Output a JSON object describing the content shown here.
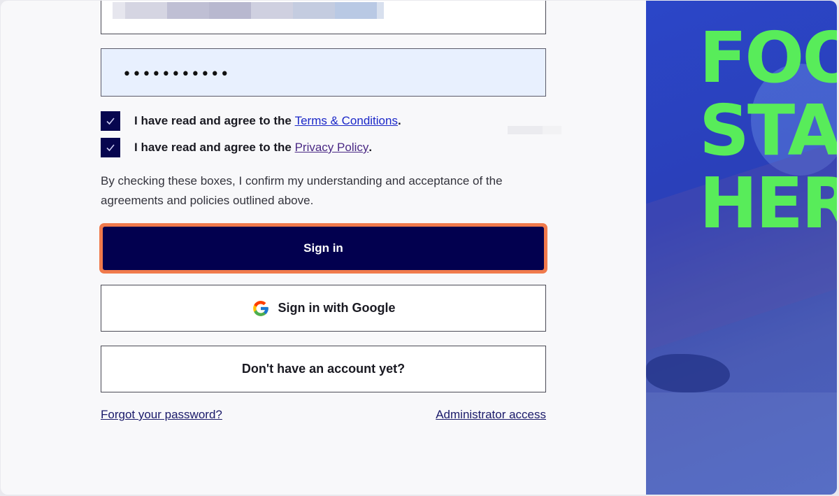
{
  "form": {
    "password_mask": "•••••••••••",
    "terms_prefix": "I have read and agree to the ",
    "terms_link": "Terms & Conditions",
    "terms_suffix": ".",
    "privacy_prefix": "I have read and agree to the ",
    "privacy_link": "Privacy Policy",
    "privacy_suffix": ".",
    "consent_text": "By checking these boxes, I confirm my understanding and acceptance of the agreements and policies outlined above.",
    "signin_label": "Sign in",
    "google_label": "Sign in with Google",
    "signup_label": "Don't have an account yet?",
    "forgot_label": "Forgot your password?",
    "admin_label": "Administrator access"
  },
  "checkboxes": {
    "terms_checked": true,
    "privacy_checked": true
  },
  "hero": {
    "lines": [
      "FOOT",
      "STAR",
      "HERE"
    ]
  },
  "colors": {
    "primary": "#02004f",
    "accent_outline": "#f07a4c",
    "hero_text": "#58ec5a",
    "link": "#1a27c8"
  },
  "icons": {
    "check": "check-icon",
    "google": "google-icon"
  }
}
